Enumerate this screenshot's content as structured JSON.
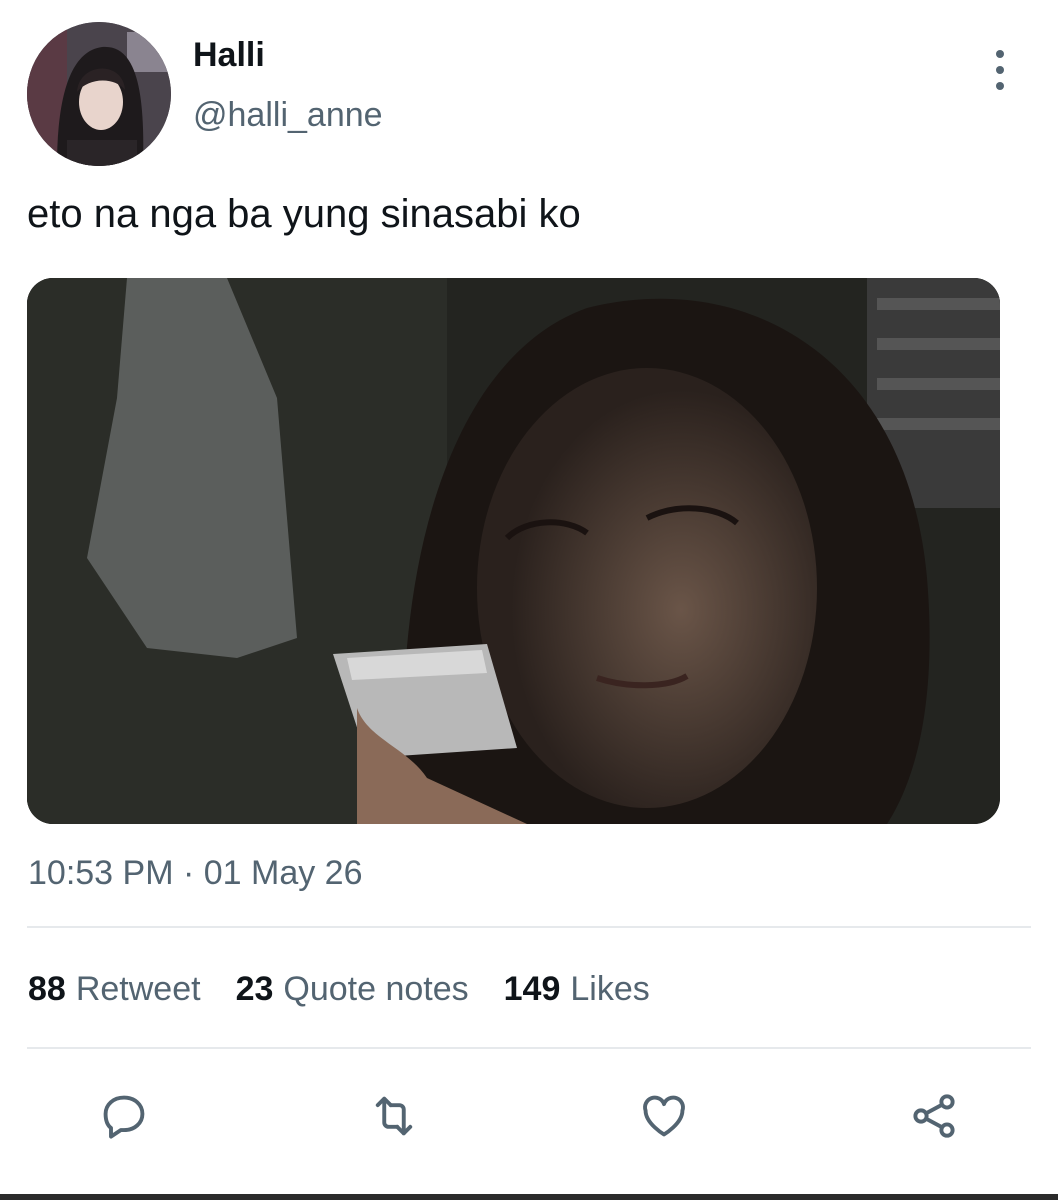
{
  "author": {
    "display_name": "Halli",
    "handle": "@halli_anne"
  },
  "tweet": {
    "text": "eto na nga ba yung sinasabi ko",
    "timestamp": "10:53 PM · 01 May 26"
  },
  "stats": [
    {
      "count": "88",
      "label": "Retweet"
    },
    {
      "count": "23",
      "label": "Quote notes"
    },
    {
      "count": "149",
      "label": "Likes"
    }
  ],
  "actions": [
    "reply-icon",
    "retweet-icon",
    "like-icon",
    "share-icon"
  ],
  "colors": {
    "text_primary": "#0f1419",
    "text_secondary": "#536471",
    "divider": "#e6e9ec"
  }
}
